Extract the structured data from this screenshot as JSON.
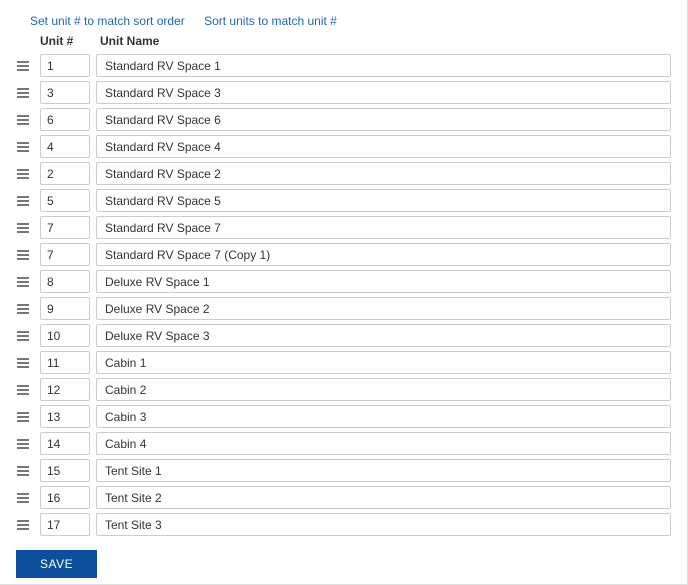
{
  "links": {
    "set_unit_num": "Set unit # to match sort order",
    "sort_units": "Sort units to match unit #"
  },
  "headers": {
    "unit_num": "Unit #",
    "unit_name": "Unit Name"
  },
  "units": [
    {
      "num": "1",
      "name": "Standard RV Space 1"
    },
    {
      "num": "3",
      "name": "Standard RV Space 3"
    },
    {
      "num": "6",
      "name": "Standard RV Space 6"
    },
    {
      "num": "4",
      "name": "Standard RV Space 4"
    },
    {
      "num": "2",
      "name": "Standard RV Space 2"
    },
    {
      "num": "5",
      "name": "Standard RV Space 5"
    },
    {
      "num": "7",
      "name": "Standard RV Space 7"
    },
    {
      "num": "7",
      "name": "Standard RV Space 7 (Copy 1)"
    },
    {
      "num": "8",
      "name": "Deluxe RV Space 1"
    },
    {
      "num": "9",
      "name": "Deluxe RV Space 2"
    },
    {
      "num": "10",
      "name": "Deluxe RV Space 3"
    },
    {
      "num": "11",
      "name": "Cabin 1"
    },
    {
      "num": "12",
      "name": "Cabin 2"
    },
    {
      "num": "13",
      "name": "Cabin 3"
    },
    {
      "num": "14",
      "name": "Cabin 4"
    },
    {
      "num": "15",
      "name": "Tent Site 1"
    },
    {
      "num": "16",
      "name": "Tent Site 2"
    },
    {
      "num": "17",
      "name": "Tent Site 3"
    }
  ],
  "buttons": {
    "save": "SAVE"
  }
}
